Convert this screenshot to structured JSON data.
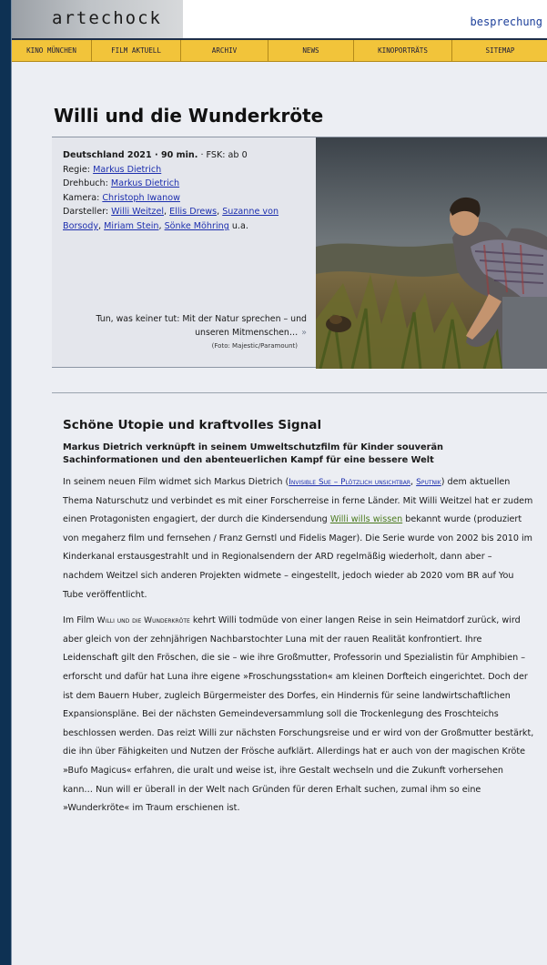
{
  "header": {
    "logo_text": "artechock",
    "section": "besprechung"
  },
  "nav": [
    {
      "label": "KINO MÜNCHEN"
    },
    {
      "label": "FILM AKTUELL"
    },
    {
      "label": "ARCHIV"
    },
    {
      "label": "NEWS"
    },
    {
      "label": "KINOPORTRÄTS"
    },
    {
      "label": "SITEMAP"
    }
  ],
  "film": {
    "title": "Willi und die Wunderkröte",
    "meta_bold": "Deutschland 2021 · 90 min.",
    "fsk": " · FSK: ab 0",
    "regie_label": "Regie: ",
    "regie": "Markus Dietrich",
    "drehbuch_label": "Drehbuch: ",
    "drehbuch": "Markus Dietrich",
    "kamera_label": "Kamera: ",
    "kamera": "Christoph Iwanow",
    "darsteller_label": "Darsteller: ",
    "cast": [
      "Willi Weitzel",
      "Ellis Drews",
      "Suzanne von Borsody",
      "Miriam Stein",
      "Sönke Möhring"
    ],
    "cast_suffix": " u.a.",
    "caption": "Tun, was keiner tut: Mit der Natur sprechen – und unseren Mitmenschen…",
    "caption_more": "»",
    "photo_credit": "(Foto: Majestic/Paramount)"
  },
  "article": {
    "heading": "Schöne Utopie und kraftvolles Signal",
    "lead": "Markus Dietrich verknüpft in seinem Umweltschutzfilm für Kinder souverän Sachinformationen und den abenteuerlichen Kampf für eine bessere Welt",
    "p1_a": "In seinem neuen Film widmet sich Markus Dietrich (",
    "p1_link1": "Invisible Sue – Plötzlich unsichtbar",
    "p1_comma": ", ",
    "p1_link2": "Sputnik",
    "p1_b": ") dem aktuellen Thema Naturschutz und verbindet es mit einer Forscherreise in ferne Länder. Mit Willi Weitzel hat er zudem einen Protagonisten engagiert, der durch die Kindersendung ",
    "p1_link3": "Willi wills wissen",
    "p1_c": " bekannt wurde (produ­ziert von megaherz film und fernsehen / Franz Gernstl und Fidelis Mager). Die Serie wurde von 2002 bis 2010 im Kinderkanal erstausgestrahlt und in Regionalsendern der ARD regelmäßig wiederholt, dann aber – nachdem Weitzel sich anderen Projekten widmete – eingestellt, jedoch wieder ab 2020 vom BR auf You Tube veröf­fentlicht.",
    "p2_a": "Im Film ",
    "p2_title": "Willi und die Wunderkröte",
    "p2_b": " kehrt Willi todmüde von einer langen Reise in sein Heimatdorf zurück, wird aber gleich von der zehnjährigen Nachbarstochter Luna mit der rauen Realität konfrontiert. Ihre Leidenschaft gilt den Fröschen, die sie – wie ihre Großmutter, Professorin und Spezialistin für Amphibien – erforscht und dafür hat Luna ihre eigene »Froschungsstation« am kleinen Dorfteich eingerichtet. Doch der ist dem Bauern Huber, zugleich Bürgermeister des Dorfes, ein Hindernis für seine landwirtschaftlichen Expansionspläne. Bei der nächsten Gemeindeversamm­lung soll die Trockenlegung des Froschteichs beschlossen werden. Das reizt Willi zur nächsten Forschungsreise und er wird von der Großmutter bestärkt, die ihn über Fähigkeiten und Nutzen der Frösche aufklärt. Allerdings hat er auch von der magischen Kröte »Bufo Magicus« erfahren, die uralt und weise ist, ihre Gestalt wechseln und die Zukunft vorhersehen kann… Nun will er überall in der Welt nach Gründen für deren Erhalt suchen, zumal ihm so eine »Wunderkröte« im Traum erschienen ist."
  }
}
